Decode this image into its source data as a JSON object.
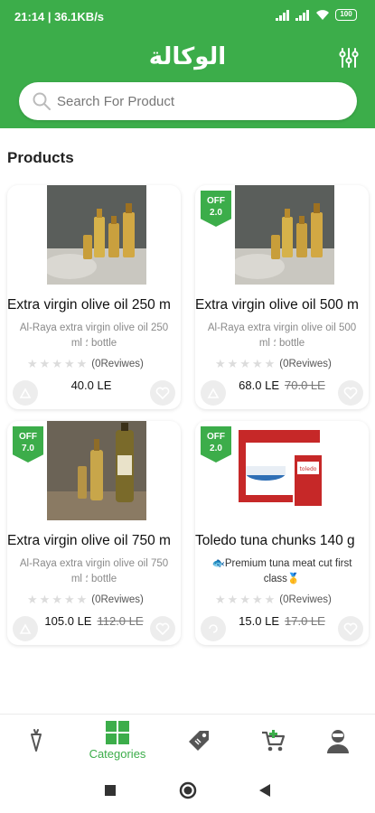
{
  "status_bar": {
    "time": "21:14 | 36.1KB/s",
    "battery": "100"
  },
  "header": {
    "title": "الوكالة",
    "search_placeholder": "Search For Product"
  },
  "section_title": "Products",
  "products": [
    {
      "name": "Extra virgin olive oil  250 m",
      "description": "Al-Raya extra virgin olive oil 250 ml ؛ bottle",
      "reviews": "(0Reviwes)",
      "rating_stars": 0,
      "price": "40.0 LE",
      "old_price": "",
      "badge": {
        "line1": "",
        "line2": ""
      }
    },
    {
      "name": "Extra virgin olive oil  500 m",
      "description": "Al-Raya extra virgin olive oil 500 ml ؛ bottle",
      "reviews": "(0Reviwes)",
      "rating_stars": 0,
      "price": "68.0 LE",
      "old_price": "70.0 LE",
      "badge": {
        "line1": "OFF",
        "line2": "2.0"
      }
    },
    {
      "name": "Extra virgin olive oil  750 m",
      "description": "Al-Raya extra virgin olive oil 750 ml ؛ bottle",
      "reviews": "(0Reviwes)",
      "rating_stars": 0,
      "price": "105.0 LE",
      "old_price": "112.0 LE",
      "badge": {
        "line1": "OFF",
        "line2": "7.0"
      }
    },
    {
      "name": "Toledo tuna chunks  140 g",
      "description": "🐟Premium tuna meat cut first class🥇",
      "reviews": "(0Reviwes)",
      "rating_stars": 0,
      "price": "15.0 LE",
      "old_price": "17.0 LE",
      "badge": {
        "line1": "OFF",
        "line2": "2.0"
      }
    }
  ],
  "bottom_nav": {
    "items": [
      {
        "icon": "carrot-icon",
        "label": ""
      },
      {
        "icon": "categories-grid-icon",
        "label": "Categories"
      },
      {
        "icon": "price-tag-icon",
        "label": ""
      },
      {
        "icon": "cart-icon",
        "label": ""
      },
      {
        "icon": "profile-icon",
        "label": ""
      }
    ],
    "active_index": 1
  },
  "colors": {
    "primary": "#3cad4a",
    "background": "#ffffff",
    "badge": "#3cad4a"
  }
}
